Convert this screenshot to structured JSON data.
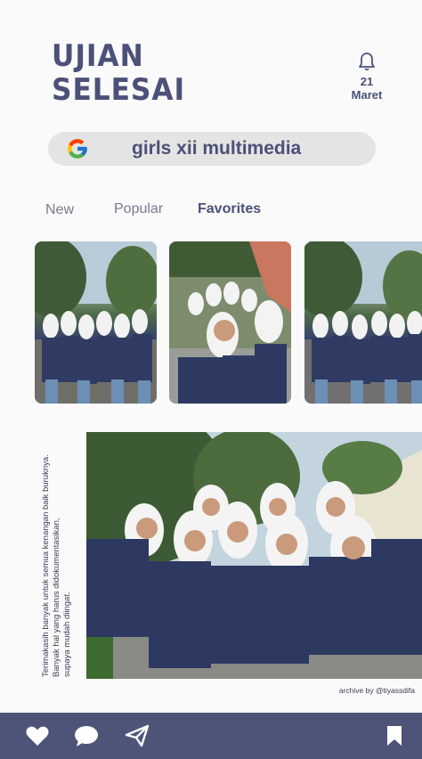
{
  "header": {
    "logo_line1": "UJIAN",
    "logo_line2": "SELESAI",
    "date_day": "21",
    "date_month": "Maret"
  },
  "search": {
    "query": "girls xii multimedia"
  },
  "tabs": [
    {
      "label": "New",
      "active": false
    },
    {
      "label": "Popular",
      "active": false
    },
    {
      "label": "Favorites",
      "active": true
    }
  ],
  "caption": {
    "line1": "Terimakasih banyak untuk semua kenangan baik buruknya.",
    "line2": "Banyak hal yang harus didokumentasikan,",
    "line3": "supaya mudah diingat."
  },
  "archive_credit": "archive by @tiyassdifa",
  "colors": {
    "brand": "#4b5178",
    "bar": "#4d5478",
    "search_bg": "#e4e4e4"
  },
  "icons": {
    "bell": "bell-icon",
    "google": "google-icon",
    "heart": "heart-icon",
    "chat": "chat-bubble-icon",
    "send": "send-icon",
    "bookmark": "bookmark-icon"
  }
}
